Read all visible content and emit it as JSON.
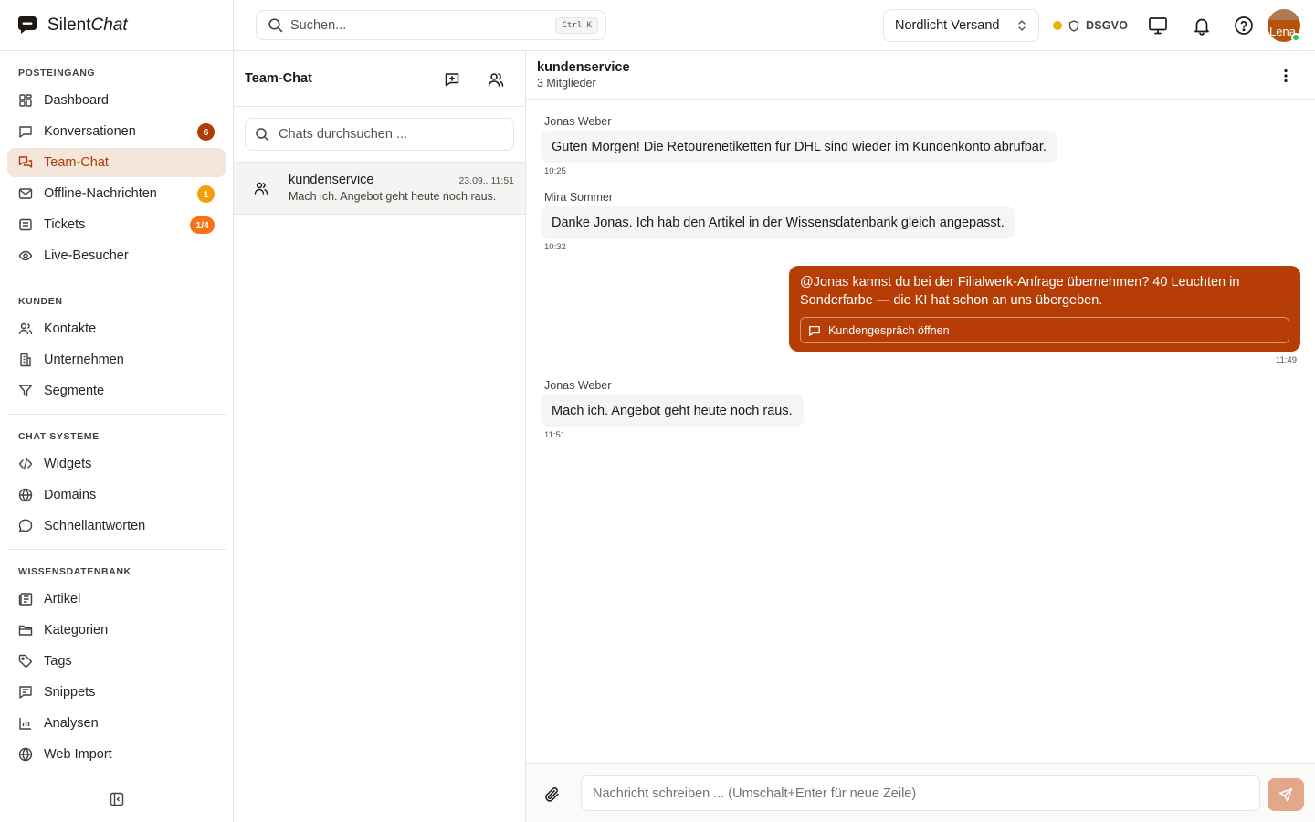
{
  "brand": {
    "name_regular": "Silent",
    "name_italic": "Chat"
  },
  "sidebar": {
    "sections": [
      {
        "label": "POSTEINGANG",
        "items": [
          {
            "label": "Dashboard",
            "icon": "dashboard-icon"
          },
          {
            "label": "Konversationen",
            "icon": "message-square-icon",
            "badge": "6",
            "badge_color": "#b13d05"
          },
          {
            "label": "Team-Chat",
            "icon": "messages-icon",
            "active": true
          },
          {
            "label": "Offline-Nachrichten",
            "icon": "mail-icon",
            "badge": "1",
            "badge_color": "#f59e0b"
          },
          {
            "label": "Tickets",
            "icon": "ticket-icon",
            "badge": "1/4",
            "badge_color": "#f97316"
          },
          {
            "label": "Live-Besucher",
            "icon": "eye-icon"
          }
        ]
      },
      {
        "label": "KUNDEN",
        "items": [
          {
            "label": "Kontakte",
            "icon": "users-icon"
          },
          {
            "label": "Unternehmen",
            "icon": "building-icon"
          },
          {
            "label": "Segmente",
            "icon": "filter-icon"
          }
        ]
      },
      {
        "label": "CHAT-SYSTEME",
        "items": [
          {
            "label": "Widgets",
            "icon": "code-icon"
          },
          {
            "label": "Domains",
            "icon": "globe-icon"
          },
          {
            "label": "Schnellantworten",
            "icon": "message-circle-icon"
          }
        ]
      },
      {
        "label": "WISSENSDATENBANK",
        "items": [
          {
            "label": "Artikel",
            "icon": "newspaper-icon"
          },
          {
            "label": "Kategorien",
            "icon": "folder-icon"
          },
          {
            "label": "Tags",
            "icon": "tag-icon"
          },
          {
            "label": "Snippets",
            "icon": "snippet-icon"
          },
          {
            "label": "Analysen",
            "icon": "bar-chart-icon"
          },
          {
            "label": "Web Import",
            "icon": "globe-icon"
          }
        ]
      }
    ]
  },
  "topbar": {
    "search_placeholder": "Suchen...",
    "search_shortcut": "Ctrl K",
    "store": "Nordlicht Versand",
    "status_dot_color": "#eab308",
    "compliance": "DSGVO",
    "avatar_text": "Lena",
    "online_color": "#22c55e"
  },
  "chatlist": {
    "title": "Team-Chat",
    "search_placeholder": "Chats durchsuchen ...",
    "items": [
      {
        "name": "kundenservice",
        "time": "23.09., 11:51",
        "preview": "Mach ich. Angebot geht heute noch raus."
      }
    ]
  },
  "conversation": {
    "title": "kundenservice",
    "subtitle": "3 Mitglieder",
    "messages": [
      {
        "sender": "Jonas Weber",
        "text": "Guten Morgen! Die Retourenetiketten für DHL sind wieder im Kundenkonto abrufbar.",
        "time": "10:25"
      },
      {
        "sender": "Mira Sommer",
        "text": "Danke Jonas. Ich hab den Artikel in der Wissensdatenbank gleich angepasst.",
        "time": "10:32"
      },
      {
        "sender": "",
        "own": true,
        "text": "@Jonas kannst du bei der Filialwerk-Anfrage übernehmen? 40 Leuchten in Sonderfarbe — die KI hat schon an uns übergeben.",
        "button": "Kundengespräch öffnen",
        "time": "11:49"
      },
      {
        "sender": "Jonas Weber",
        "text": "Mach ich. Angebot geht heute noch raus.",
        "time": "11:51"
      }
    ],
    "composer_placeholder": "Nachricht schreiben ... (Umschalt+Enter für neue Zeile)"
  },
  "colors": {
    "accent": "#b73d06",
    "accent_light": "#f5e6dc",
    "send_button": "#e3a78a"
  }
}
